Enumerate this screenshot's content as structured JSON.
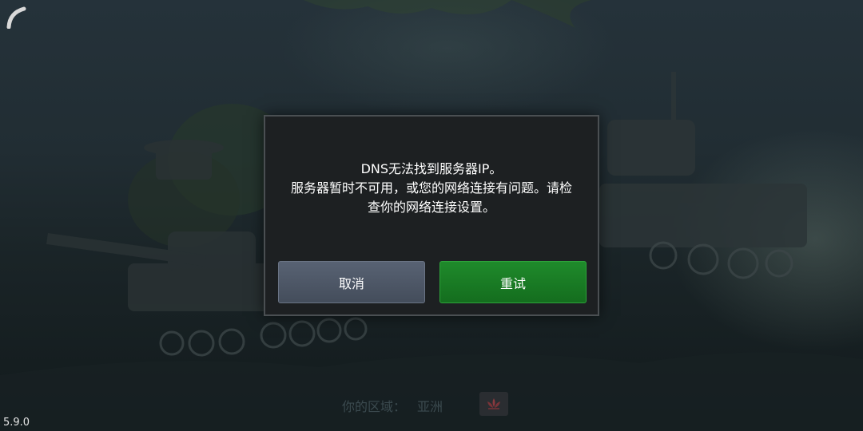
{
  "dialog": {
    "message_lines": [
      "DNS无法找到服务器IP。",
      "服务器暂时不可用，或您的网络连接有问题。请检",
      "查你的网络连接设置。"
    ],
    "cancel_label": "取消",
    "retry_label": "重试"
  },
  "footer": {
    "region_label": "你的区域：",
    "region_value": "亚洲",
    "region_icon": "lotus-icon",
    "version": "5.9.0"
  },
  "colors": {
    "retry_button": "#1a7d26",
    "cancel_button": "#4e5766",
    "dialog_bg": "#1d2022"
  }
}
